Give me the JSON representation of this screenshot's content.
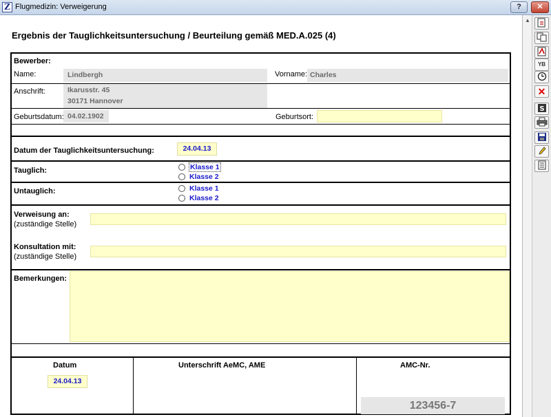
{
  "window": {
    "title": "Flugmedizin: Verweigerung",
    "icon_letter": "Z",
    "help_label": "?",
    "close_label": "✕"
  },
  "page_title": "Ergebnis der Tauglichkeitsuntersuchung / Beurteilung gemäß MED.A.025 (4)",
  "applicant": {
    "section_label": "Bewerber:",
    "name_label": "Name:",
    "name_value": "Lindbergh",
    "firstname_label": "Vorname:",
    "firstname_value": "Charles",
    "address_label": "Anschrift:",
    "address_line1": "Ikarusstr. 45",
    "address_line2": "30171  Hannover",
    "birthdate_label": "Geburtsdatum:",
    "birthdate_value": "04.02.1902",
    "birthplace_label": "Geburtsort:",
    "birthplace_value": ""
  },
  "exam": {
    "date_label": "Datum der Tauglichkeitsuntersuchung:",
    "date_value": "24.04.13"
  },
  "fit": {
    "label": "Tauglich:",
    "options": [
      "Klasse 1",
      "Klasse 2"
    ]
  },
  "unfit": {
    "label": "Untauglich:",
    "options": [
      "Klasse 1",
      "Klasse 2"
    ]
  },
  "referral": {
    "label": "Verweisung an:",
    "sublabel": "(zuständige Stelle)",
    "value": ""
  },
  "consultation": {
    "label": "Konsultation mit:",
    "sublabel": "(zuständige Stelle)",
    "value": ""
  },
  "remarks": {
    "label": "Bemerkungen:",
    "value": ""
  },
  "footer": {
    "date_header": "Datum",
    "date_value": "24.04.13",
    "signature_header": "Unterschrift AeMC, AME",
    "amc_header": "AMC-Nr.",
    "amc_value": "123456-7"
  },
  "toolbar": {
    "tools": [
      "new-document-icon",
      "copy-icon",
      "pdf-icon",
      "text-transform-icon",
      "clock-icon",
      "delete-icon",
      "s-icon",
      "print-icon",
      "save-icon",
      "edit-icon",
      "notes-icon"
    ]
  },
  "colors": {
    "field_yellow": "#ffffcc",
    "field_gray": "#e6e6e6",
    "value_blue": "#1a1acc"
  }
}
